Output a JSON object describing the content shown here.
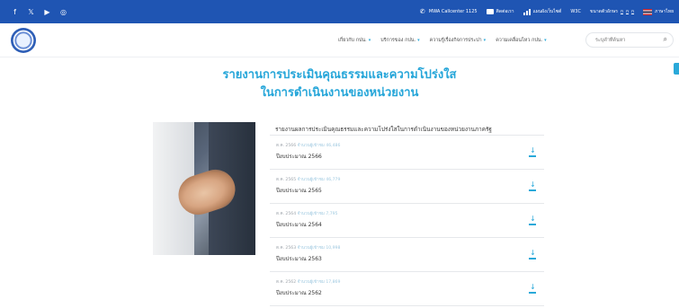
{
  "topbar": {
    "social": [
      {
        "icon": "facebook-icon",
        "glyph": "f"
      },
      {
        "icon": "x-icon",
        "glyph": "𝕏"
      },
      {
        "icon": "youtube-icon",
        "glyph": "▶"
      },
      {
        "icon": "instagram-icon",
        "glyph": "◎"
      }
    ],
    "callcenter": "MWA Callcenter 1125",
    "contact": "ติดต่อเรา",
    "sitemap": "แผนผังเว็บไซต์",
    "w3c": "W3C",
    "fontsize_label": "ขนาดตัวอักษร",
    "fontsize_options": [
      "ก",
      "ก",
      "ก"
    ],
    "language": "ภาษาไทย"
  },
  "nav": {
    "menu": [
      {
        "label": "เกี่ยวกับ กปน.",
        "caret": "▾"
      },
      {
        "label": "บริการของ กปน.",
        "caret": "▾"
      },
      {
        "label": "ความรู้เรื่องกิจการประปา",
        "caret": "▾"
      },
      {
        "label": "ความเคลื่อนไหว กปน.",
        "caret": "▾"
      }
    ],
    "search_placeholder": "ระบุคำที่ค้นหา",
    "search_icon": "⌕"
  },
  "page": {
    "title_line1": "รายงานการประเมินคุณธรรมและความโปร่งใส",
    "title_line2": "ในการดำเนินงานของหน่วยงาน"
  },
  "section": {
    "heading": "รายงานผลการประเมินคุณธรรมและความโปร่งใสในการดำเนินงานของหน่วยงานภาครัฐ",
    "items": [
      {
        "date": "ต.ค. 2566",
        "count": "จำนวนผู้เข้าชม 46,486",
        "year": "ปีงบประมาณ 2566"
      },
      {
        "date": "ต.ค. 2565",
        "count": "จำนวนผู้เข้าชม 46,779",
        "year": "ปีงบประมาณ 2565"
      },
      {
        "date": "ต.ค. 2564",
        "count": "จำนวนผู้เข้าชม 7,795",
        "year": "ปีงบประมาณ 2564"
      },
      {
        "date": "ต.ค. 2563",
        "count": "จำนวนผู้เข้าชม 10,998",
        "year": "ปีงบประมาณ 2563"
      },
      {
        "date": "ต.ค. 2562",
        "count": "จำนวนผู้เข้าชม 17,869",
        "year": "ปีงบประมาณ 2562"
      }
    ]
  },
  "colors": {
    "topbar": "#1f55b3",
    "accent": "#26a6d9"
  }
}
